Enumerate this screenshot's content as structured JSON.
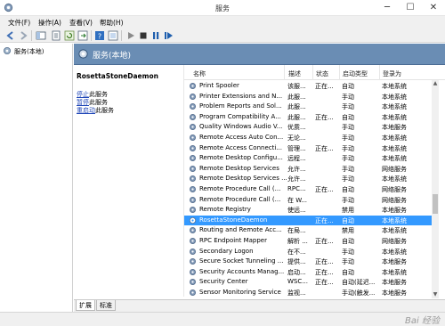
{
  "window": {
    "title": "服务",
    "minimize": "─",
    "maximize": "☐",
    "close": "✕"
  },
  "menu": [
    "文件(F)",
    "操作(A)",
    "查看(V)",
    "帮助(H)"
  ],
  "tree": {
    "root_label": "服务(本地)"
  },
  "header": {
    "title": "服务(本地)"
  },
  "detail": {
    "service_name": "RosettaStoneDaemon",
    "stop_link": "停止",
    "stop_suffix": "此服务",
    "pause_link": "暂停",
    "pause_suffix": "此服务",
    "restart_link": "重启动",
    "restart_suffix": "此服务"
  },
  "columns": {
    "name": "名称",
    "desc": "描述",
    "status": "状态",
    "startup": "启动类型",
    "logon": "登录为"
  },
  "rows": [
    {
      "name": "Print Spooler",
      "desc": "该服...",
      "status": "正在...",
      "startup": "自动",
      "logon": "本地系统"
    },
    {
      "name": "Printer Extensions and N...",
      "desc": "此服...",
      "status": "",
      "startup": "手动",
      "logon": "本地系统"
    },
    {
      "name": "Problem Reports and Sol...",
      "desc": "此服...",
      "status": "",
      "startup": "手动",
      "logon": "本地系统"
    },
    {
      "name": "Program Compatibility A...",
      "desc": "此服...",
      "status": "正在...",
      "startup": "自动",
      "logon": "本地系统"
    },
    {
      "name": "Quality Windows Audio V...",
      "desc": "优质...",
      "status": "",
      "startup": "手动",
      "logon": "本地服务"
    },
    {
      "name": "Remote Access Auto Con...",
      "desc": "无论...",
      "status": "",
      "startup": "手动",
      "logon": "本地系统"
    },
    {
      "name": "Remote Access Connecti...",
      "desc": "管理...",
      "status": "正在...",
      "startup": "手动",
      "logon": "本地系统"
    },
    {
      "name": "Remote Desktop Configu...",
      "desc": "远程...",
      "status": "",
      "startup": "手动",
      "logon": "本地系统"
    },
    {
      "name": "Remote Desktop Services",
      "desc": "允许...",
      "status": "",
      "startup": "手动",
      "logon": "网络服务"
    },
    {
      "name": "Remote Desktop Services ...",
      "desc": "允许...",
      "status": "",
      "startup": "手动",
      "logon": "本地系统"
    },
    {
      "name": "Remote Procedure Call (...",
      "desc": "RPC...",
      "status": "正在...",
      "startup": "自动",
      "logon": "网络服务"
    },
    {
      "name": "Remote Procedure Call (...",
      "desc": "在 W...",
      "status": "",
      "startup": "手动",
      "logon": "网络服务"
    },
    {
      "name": "Remote Registry",
      "desc": "使远...",
      "status": "",
      "startup": "禁用",
      "logon": "本地服务"
    },
    {
      "name": "RosettaStoneDaemon",
      "desc": "",
      "status": "正在...",
      "startup": "自动",
      "logon": "本地系统",
      "selected": true
    },
    {
      "name": "Routing and Remote Acc...",
      "desc": "在局...",
      "status": "",
      "startup": "禁用",
      "logon": "本地系统"
    },
    {
      "name": "RPC Endpoint Mapper",
      "desc": "解析 ...",
      "status": "正在...",
      "startup": "自动",
      "logon": "网络服务"
    },
    {
      "name": "Secondary Logon",
      "desc": "在不...",
      "status": "",
      "startup": "手动",
      "logon": "本地系统"
    },
    {
      "name": "Secure Socket Tunneling ...",
      "desc": "提供...",
      "status": "正在...",
      "startup": "手动",
      "logon": "本地服务"
    },
    {
      "name": "Security Accounts Manag...",
      "desc": "启动...",
      "status": "正在...",
      "startup": "自动",
      "logon": "本地系统"
    },
    {
      "name": "Security Center",
      "desc": "WSC...",
      "status": "正在...",
      "startup": "自动(延迟...",
      "logon": "本地服务"
    },
    {
      "name": "Sensor Monitoring Service",
      "desc": "监视...",
      "status": "",
      "startup": "手动(触发...",
      "logon": "本地服务"
    }
  ],
  "tabs": [
    "扩展",
    "标准"
  ],
  "watermark": "Bai 经验"
}
